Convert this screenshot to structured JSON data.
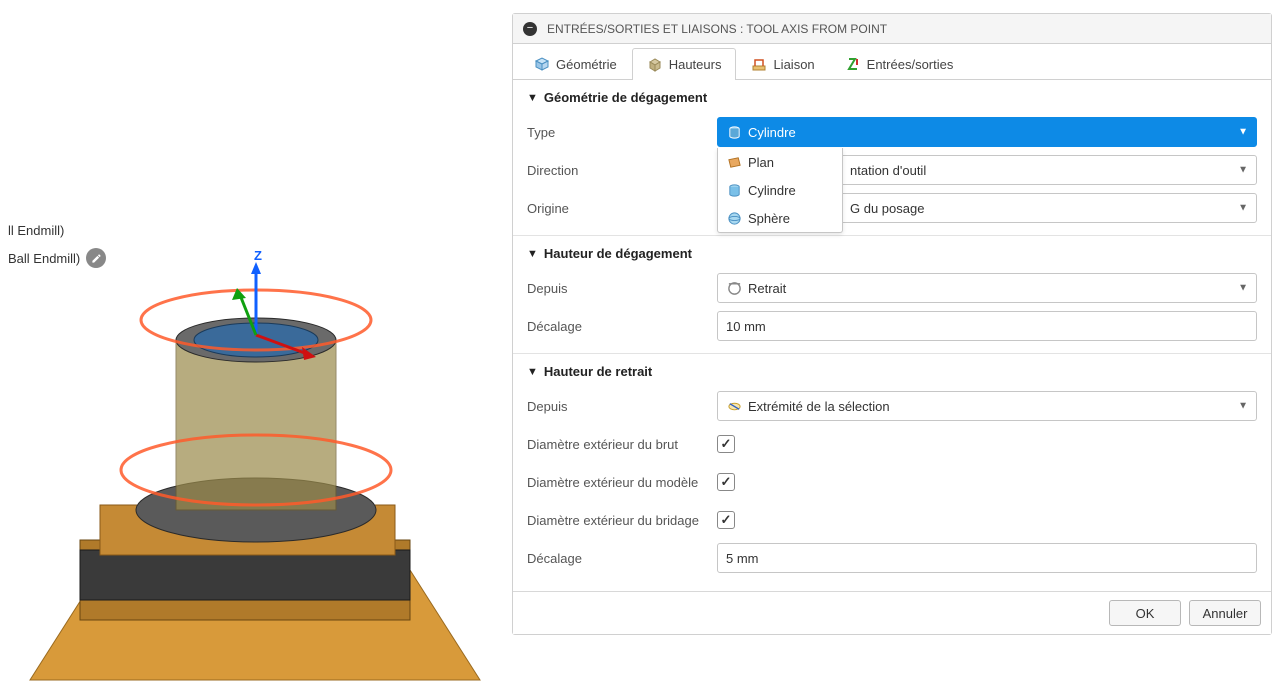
{
  "tree": {
    "item1": "ll Endmill)",
    "item2": "Ball Endmill)"
  },
  "axis": {
    "z": "Z"
  },
  "panel": {
    "title": "ENTRÉES/SORTIES ET LIAISONS : TOOL AXIS FROM POINT",
    "tabs": {
      "geometry": "Géométrie",
      "heights": "Hauteurs",
      "link": "Liaison",
      "io": "Entrées/sorties"
    },
    "sections": {
      "clearance_geom": {
        "title": "Géométrie de dégagement",
        "type_label": "Type",
        "type_value": "Cylindre",
        "type_options": {
          "plan": "Plan",
          "cylindre": "Cylindre",
          "sphere": "Sphère"
        },
        "direction_label": "Direction",
        "direction_value_suffix": "ntation d'outil",
        "origin_label": "Origine",
        "origin_value_suffix": "G du posage"
      },
      "clearance_height": {
        "title": "Hauteur de dégagement",
        "from_label": "Depuis",
        "from_value": "Retrait",
        "offset_label": "Décalage",
        "offset_value": "10 mm"
      },
      "retract_height": {
        "title": "Hauteur de retrait",
        "from_label": "Depuis",
        "from_value": "Extrémité de la sélection",
        "stock_od_label": "Diamètre extérieur du brut",
        "model_od_label": "Diamètre extérieur du modèle",
        "fixture_od_label": "Diamètre extérieur du bridage",
        "offset_label": "Décalage",
        "offset_value": "5 mm"
      }
    },
    "footer": {
      "ok": "OK",
      "cancel": "Annuler"
    }
  }
}
